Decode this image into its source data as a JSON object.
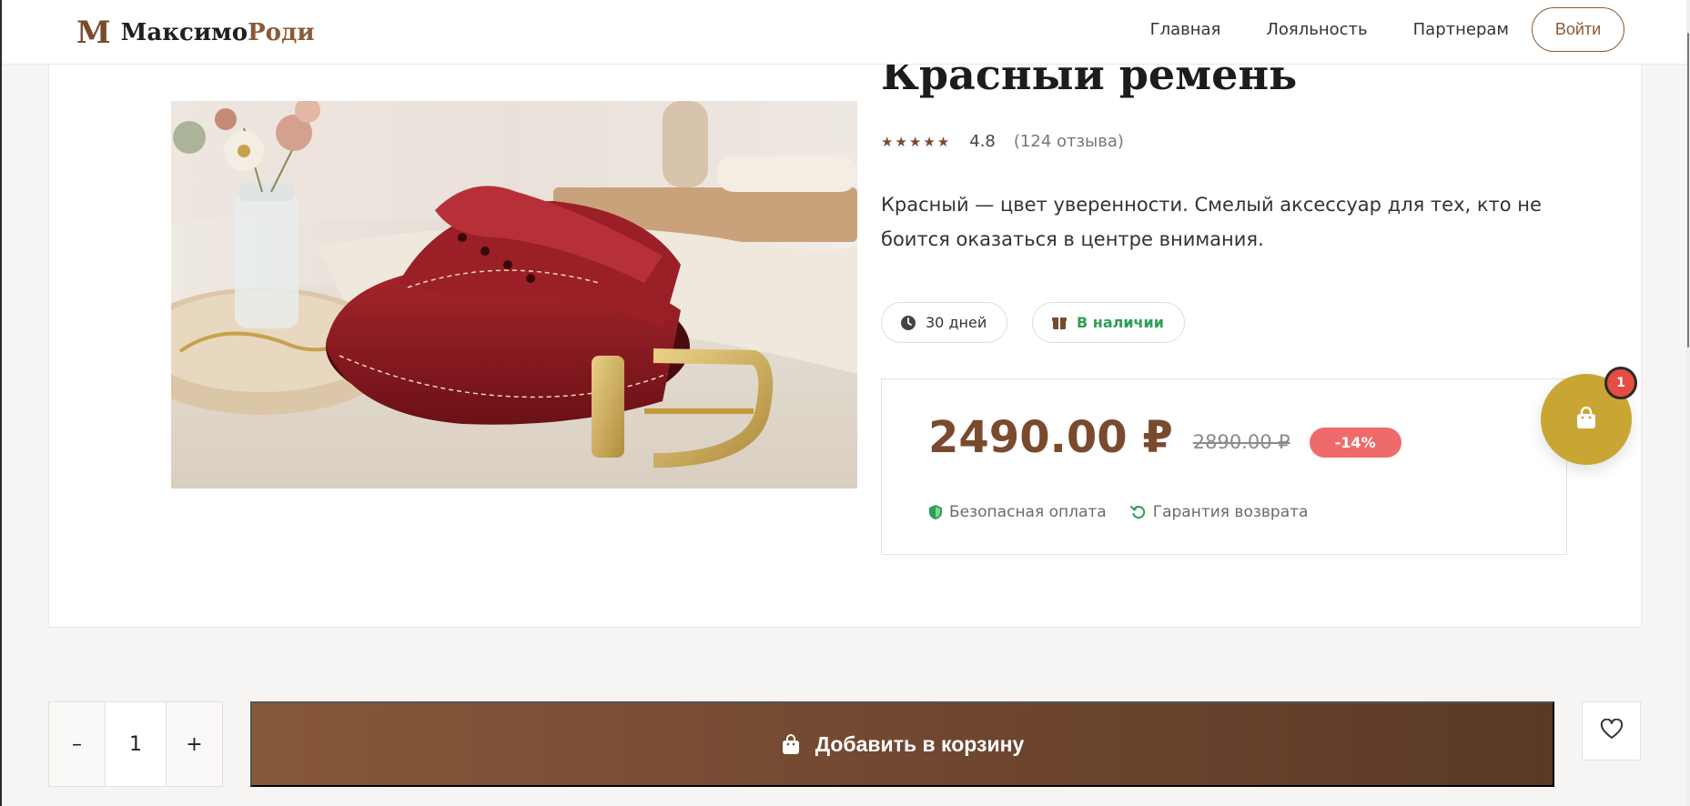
{
  "header": {
    "logo_mark": "M",
    "logo_name_part1": "Максимо",
    "logo_name_part2": "Роди",
    "nav": [
      {
        "label": "Главная"
      },
      {
        "label": "Лояльность"
      },
      {
        "label": "Партнерам"
      }
    ],
    "login_label": "Войти"
  },
  "product": {
    "title": "Красный ремень",
    "stars": "★★★★★",
    "rating": "4.8",
    "reviews": "(124 отзыва)",
    "description": "Красный — цвет уверенности. Смелый аксессуар для тех, кто не боится оказаться в центре внимания.",
    "delivery": "30 дней",
    "stock": "В наличии",
    "price": "2490.00 ₽",
    "old_price": "2890.00 ₽",
    "discount": "-14%",
    "secure_payment": "Безопасная оплата",
    "return_guarantee": "Гарантия возврата"
  },
  "cart": {
    "count": "1"
  },
  "purchase": {
    "minus": "–",
    "quantity": "1",
    "plus": "+",
    "add_label": "Добавить в корзину"
  },
  "colors": {
    "brand_brown": "#7a4a2e",
    "gold": "#c9a534",
    "in_stock_green": "#2f9e55",
    "discount_red": "#ef6b6b"
  },
  "icons": {
    "delivery": "clock-icon",
    "stock": "box-icon",
    "secure": "shield-icon",
    "return": "return-arrow-icon",
    "cart": "shopping-bag-icon",
    "favorite": "heart-icon"
  }
}
